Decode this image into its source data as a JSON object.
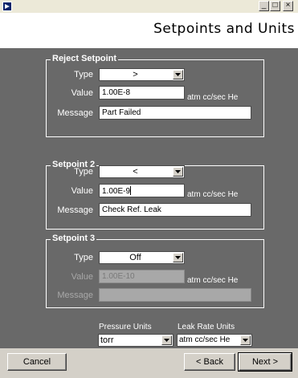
{
  "window": {
    "minimize_label": "_",
    "maximize_label": "□",
    "close_label": "×"
  },
  "header": {
    "title": "Setpoints and Units"
  },
  "reject": {
    "title": "Reject Setpoint",
    "type_label": "Type",
    "type_value": ">",
    "value_label": "Value",
    "value": "1.00E-8",
    "unit": "atm cc/sec He",
    "message_label": "Message",
    "message": "Part Failed"
  },
  "setpoint2": {
    "title": "Setpoint 2",
    "type_label": "Type",
    "type_value": "<",
    "value_label": "Value",
    "value": "1.00E-9",
    "unit": "atm cc/sec He",
    "message_label": "Message",
    "message": "Check Ref. Leak"
  },
  "setpoint3": {
    "title": "Setpoint 3",
    "type_label": "Type",
    "type_value": "Off",
    "value_label": "Value",
    "value": "1.00E-10",
    "unit": "atm cc/sec He",
    "message_label": "Message",
    "message": ""
  },
  "units": {
    "pressure_label": "Pressure Units",
    "pressure_value": "torr",
    "leak_label": "Leak Rate Units",
    "leak_value": "atm cc/sec He"
  },
  "footer": {
    "cancel_label": "Cancel",
    "back_label": "< Back",
    "next_label": "Next >"
  }
}
